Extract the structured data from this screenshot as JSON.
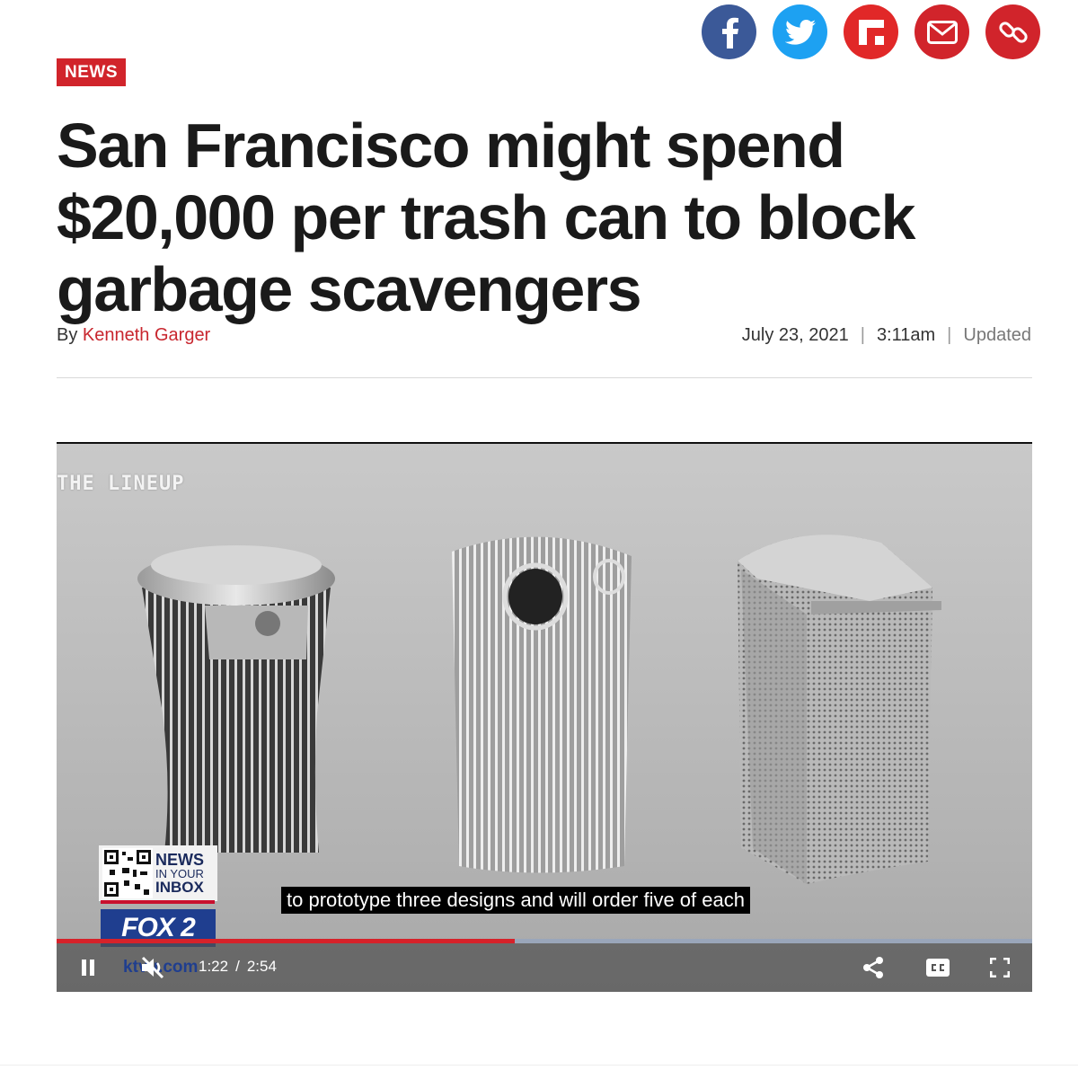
{
  "share": [
    {
      "name": "facebook",
      "icon": "facebook-icon",
      "color": "#3b5998"
    },
    {
      "name": "twitter",
      "icon": "twitter-icon",
      "color": "#1da1f2"
    },
    {
      "name": "flipboard",
      "icon": "flipboard-icon",
      "color": "#e12828"
    },
    {
      "name": "email",
      "icon": "email-icon",
      "color": "#d1242b"
    },
    {
      "name": "link",
      "icon": "link-icon",
      "color": "#d1242b"
    }
  ],
  "article": {
    "section": "NEWS",
    "headline": "San Francisco might spend $20,000 per trash can to block garbage scavengers",
    "byline_prefix": "By",
    "author": "Kenneth Garger",
    "date": "July 23, 2021",
    "time": "3:11am",
    "updated": "Updated"
  },
  "video": {
    "overlay_label": "THE LINEUP",
    "caption": "to prototype three designs and will order five of each",
    "badge": {
      "line1": "NEWS",
      "line2": "IN YOUR",
      "line3": "INBOX"
    },
    "logo_text": "FOX 2",
    "url_text": "ktvu.com",
    "current_time": "1:22",
    "duration": "2:54",
    "progress": 0.47,
    "accent": "#d6222a"
  }
}
